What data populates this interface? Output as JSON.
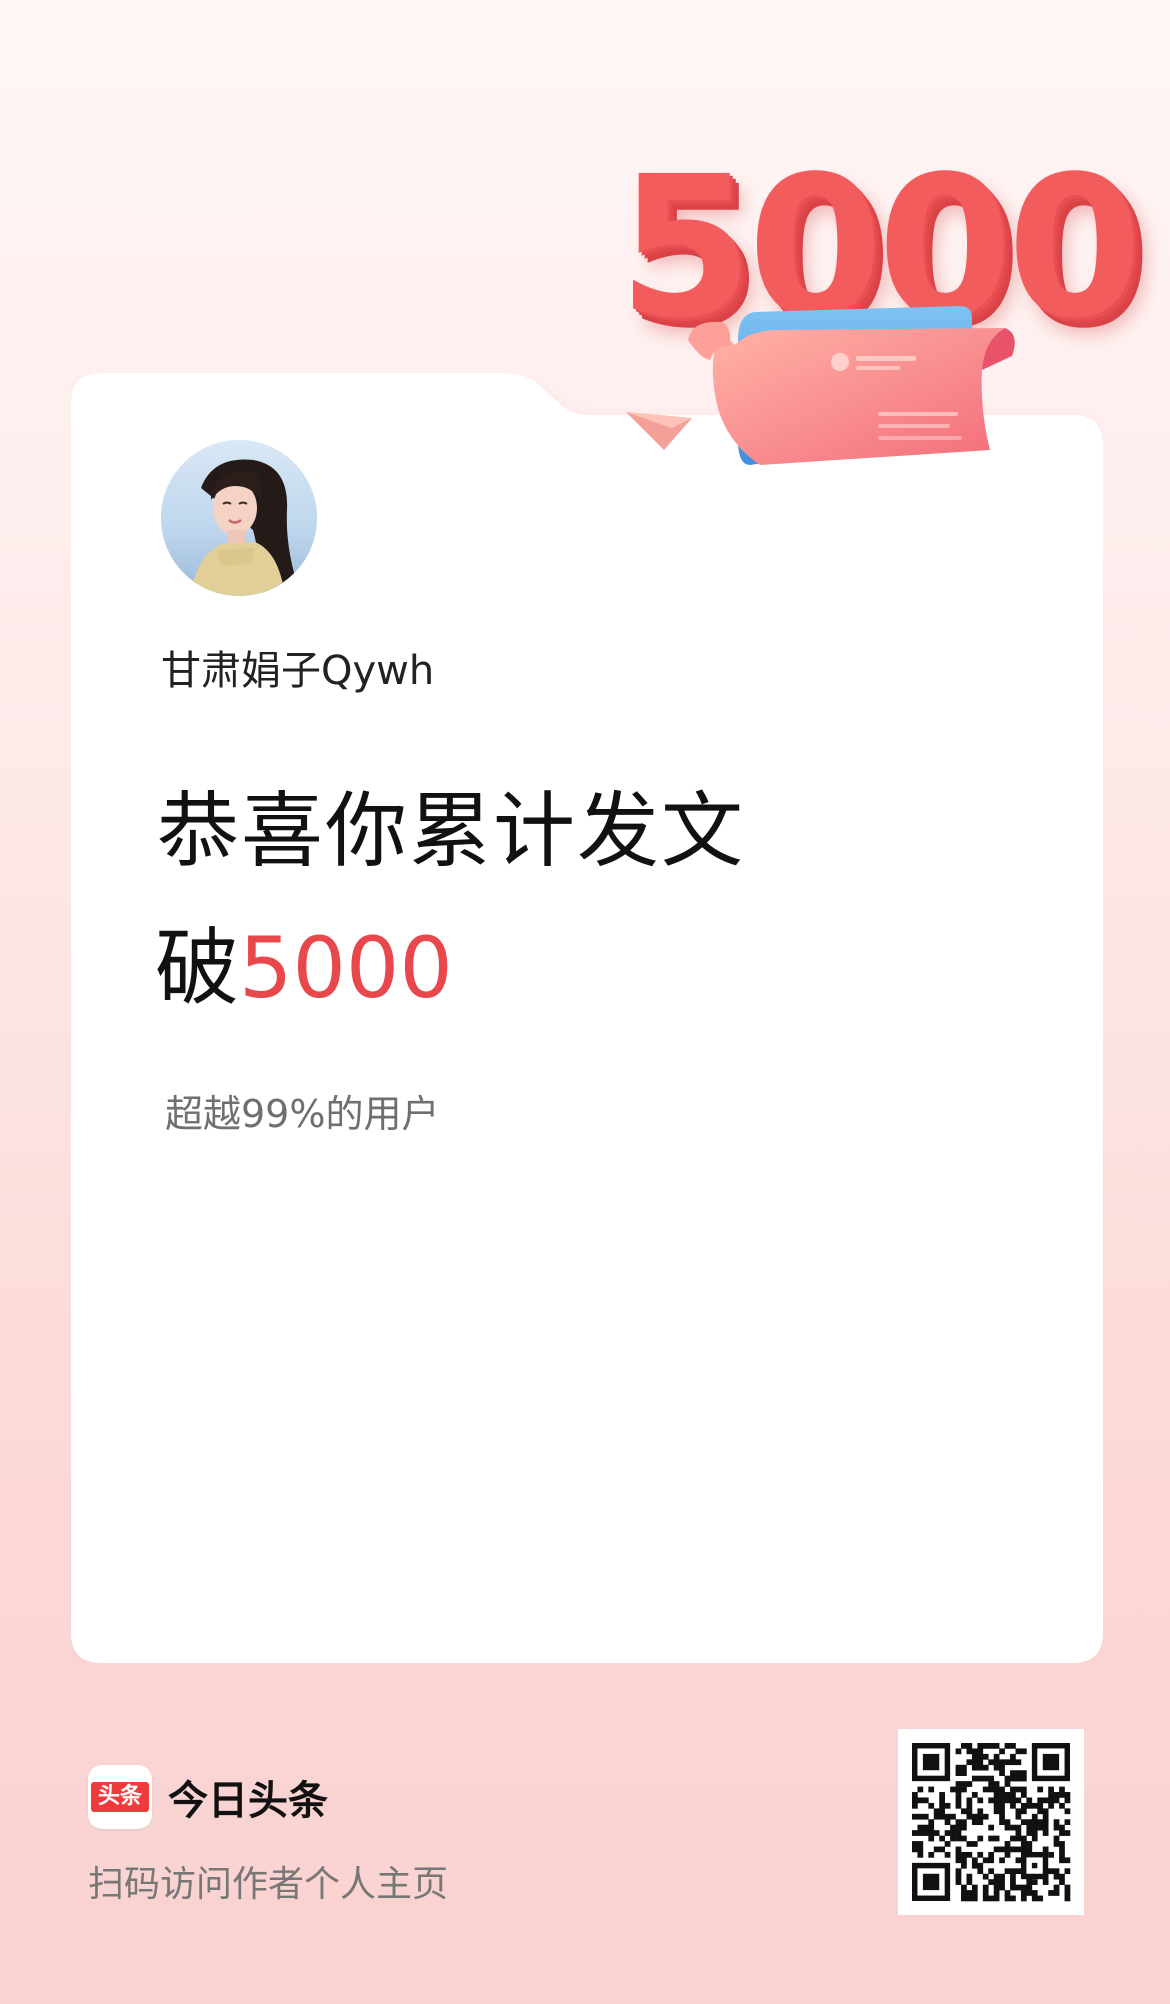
{
  "badge": {
    "number": "5000"
  },
  "profile": {
    "username": "甘肃娟子Qywh",
    "avatar_icon": "user-avatar"
  },
  "achievement": {
    "headline": "恭喜你累计发文",
    "prefix": "破",
    "count": "5000",
    "subline": "超越99%的用户"
  },
  "footer": {
    "logo_text": "头条",
    "app_name": "今日头条",
    "scan_text": "扫码访问作者个人主页",
    "qr_icon": "qr-code-icon"
  },
  "colors": {
    "accent": "#e8474b",
    "badge": "#f35c5c",
    "logo": "#ef3b3b",
    "background_top": "#fff7f6",
    "background_bottom": "#fad2d0"
  }
}
